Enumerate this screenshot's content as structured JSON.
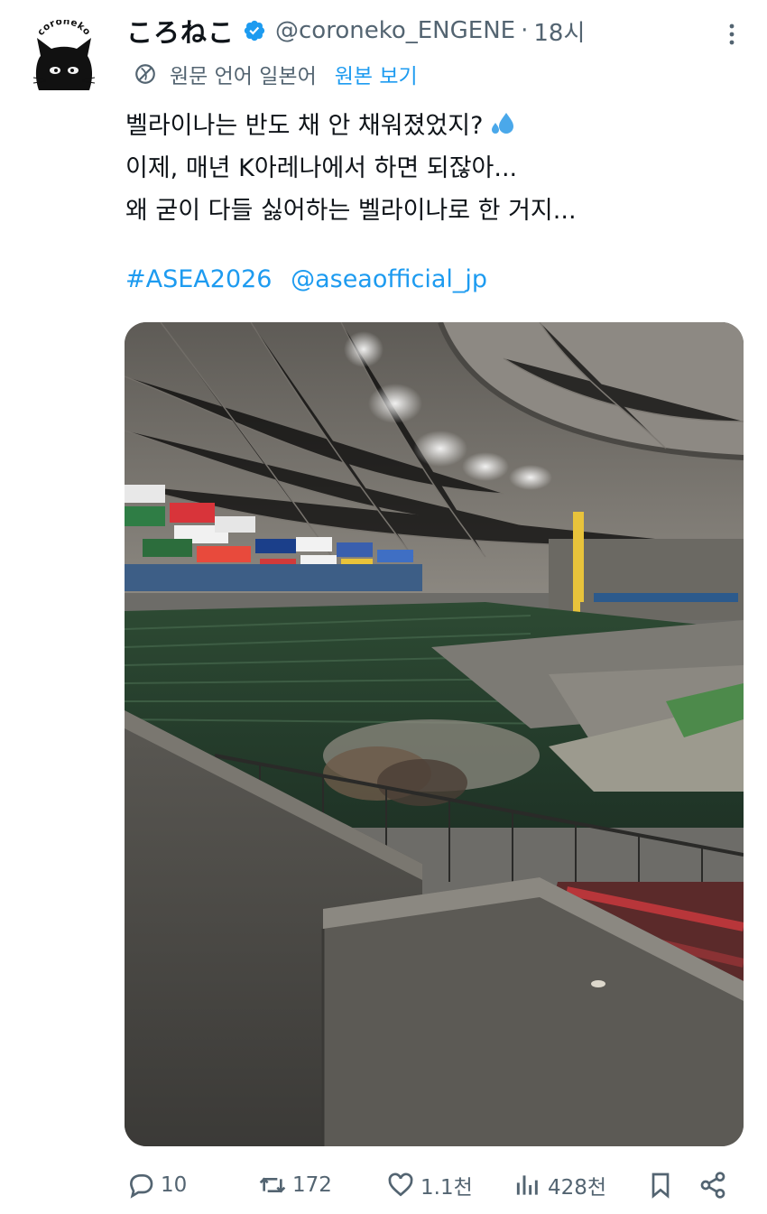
{
  "author": {
    "display_name": "ころねこ",
    "handle": "@coroneko_ENGENE",
    "separator": "·",
    "time": "18시",
    "avatar_label": "coroneko"
  },
  "translation": {
    "language_label": "원문 언어 일본어",
    "show_original": "원본 보기"
  },
  "tweet": {
    "lines": [
      "벨라이나는 반도 채 안 채워졌었지?",
      "이제, 매년 K아레나에서 하면 되잖아...",
      "왜 굳이 다들 싫어하는 벨라이나로 한 거지..."
    ],
    "hashtag": "#ASEA2026",
    "mention": "@aseaofficial_jp"
  },
  "actions": {
    "replies": "10",
    "reposts": "172",
    "likes": "1.1천",
    "views": "428천"
  },
  "colors": {
    "link": "#1d9bf0",
    "secondary_text": "#536471",
    "verified_badge": "#1d9bf0"
  }
}
